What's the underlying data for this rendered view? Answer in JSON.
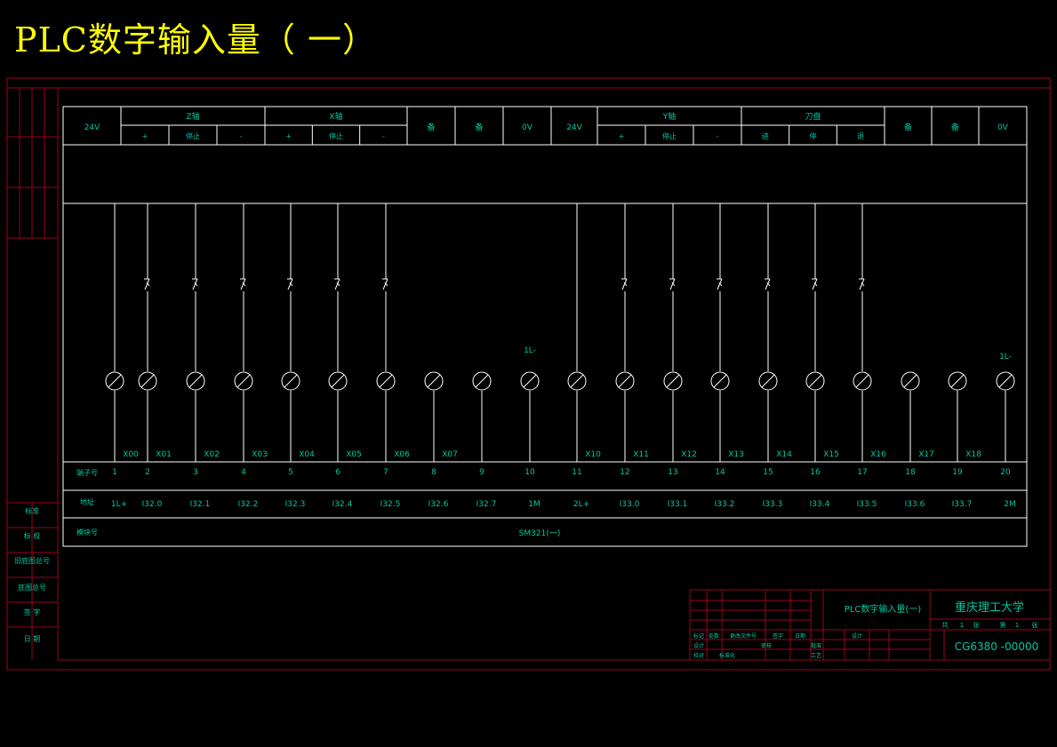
{
  "title": "PLC数字输入量（ 一）",
  "colors": {
    "border": "#a0001e",
    "frame": "#ffffff",
    "text": "#00c8a0",
    "title": "#ffff00"
  },
  "header": {
    "left_labels": [
      "24V",
      "Z轴",
      "X轴",
      "备",
      "备",
      "0V"
    ],
    "right_labels": [
      "24V",
      "Y轴",
      "刀盘",
      "备",
      "备",
      "0V"
    ],
    "z_sub": [
      "+",
      "停止",
      "-"
    ],
    "x_sub": [
      "+",
      "停止",
      "-"
    ],
    "y_sub": [
      "+",
      "停止",
      "-"
    ],
    "knife_sub": [
      "进",
      "停",
      "退"
    ]
  },
  "terminals": {
    "one_l_label": "1L-",
    "x_labels": [
      "X00",
      "X01",
      "X02",
      "X03",
      "X04",
      "X05",
      "X06",
      "X07",
      "",
      "",
      "X10",
      "X11",
      "X12",
      "X13",
      "X14",
      "X15",
      "X16",
      "X17",
      "X18",
      ""
    ],
    "row_label_terminal": "端子号",
    "numbers": [
      "1",
      "2",
      "3",
      "4",
      "5",
      "6",
      "7",
      "8",
      "9",
      "10",
      "11",
      "12",
      "13",
      "14",
      "15",
      "16",
      "17",
      "18",
      "19",
      "20"
    ],
    "row_label_address": "地址",
    "addresses": [
      "1L+",
      "I32.0",
      "I32.1",
      "I32.2",
      "I32.3",
      "I32.4",
      "I32.5",
      "I32.6",
      "I32.7",
      "1M",
      "2L+",
      "I33.0",
      "I33.1",
      "I33.2",
      "I33.3",
      "I33.4",
      "I33.5",
      "I33.6",
      "I33.7",
      "2M"
    ],
    "row_label_module": "模块号",
    "module": "SM321(一)"
  },
  "side_labels": [
    "标准",
    "标  校",
    "旧底图总号",
    "底图总号",
    "签  字",
    "日  期"
  ],
  "title_block": {
    "drawing_name": "PLC数字输入量(一)",
    "school": "重庆理工大学",
    "code": "CG6380 -00000",
    "sheet_info": [
      "共",
      "1",
      "张",
      "第",
      "1",
      "张"
    ],
    "small_labels": [
      "标记",
      "处数",
      "更改文件号",
      "签字",
      "日期",
      "设计",
      "审核",
      "批准",
      "校对",
      "标准化",
      "工艺",
      "设计"
    ]
  }
}
